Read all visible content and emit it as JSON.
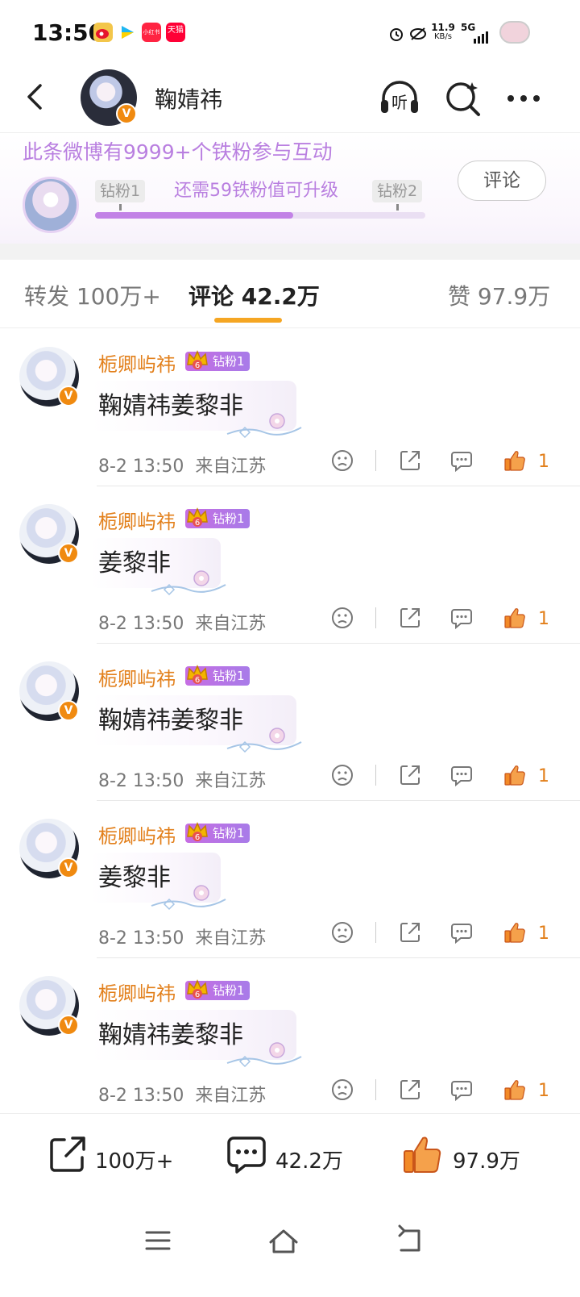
{
  "status_bar": {
    "time": "13:50",
    "app_icons": [
      {
        "name": "weibo-app-icon",
        "color": "#e6162d"
      },
      {
        "name": "video-app-icon",
        "color": "#1fb7f2"
      },
      {
        "name": "xiaohongshu-app-icon",
        "color": "#ff2442",
        "label": "小红书"
      },
      {
        "name": "tmall-app-icon",
        "color": "#ff0036",
        "label": "天猫"
      }
    ],
    "speed": "11.9",
    "speed_unit": "KB/s",
    "network": "5G"
  },
  "header": {
    "title": "鞠婧祎",
    "verified_mark": "V"
  },
  "fan_banner": {
    "title": "此条微博有9999+个铁粉参与互动",
    "level_current": "钻粉1",
    "level_message": "还需59铁粉值可升级",
    "level_next": "钻粉2",
    "progress": 0.6,
    "comment_button": "评论"
  },
  "tabs": [
    {
      "label": "转发 100万+",
      "active": false
    },
    {
      "label": "评论 42.2万",
      "active": true
    },
    {
      "label": "赞 97.9万",
      "active": false
    }
  ],
  "comments": [
    {
      "user": "栀卿屿祎",
      "badge": "钻粉1",
      "crown_level": "6",
      "verified": "V",
      "text": "鞠婧祎姜黎非",
      "time": "8-2 13:50",
      "location": "来自江苏",
      "likes": "1"
    },
    {
      "user": "栀卿屿祎",
      "badge": "钻粉1",
      "crown_level": "6",
      "verified": "V",
      "text": "姜黎非",
      "time": "8-2 13:50",
      "location": "来自江苏",
      "likes": "1"
    },
    {
      "user": "栀卿屿祎",
      "badge": "钻粉1",
      "crown_level": "6",
      "verified": "V",
      "text": "鞠婧祎姜黎非",
      "time": "8-2 13:50",
      "location": "来自江苏",
      "likes": "1"
    },
    {
      "user": "栀卿屿祎",
      "badge": "钻粉1",
      "crown_level": "6",
      "verified": "V",
      "text": "姜黎非",
      "time": "8-2 13:50",
      "location": "来自江苏",
      "likes": "1"
    },
    {
      "user": "栀卿屿祎",
      "badge": "钻粉1",
      "crown_level": "6",
      "verified": "V",
      "text": "鞠婧祎姜黎非",
      "time": "8-2 13:50",
      "location": "来自江苏",
      "likes": "1"
    }
  ],
  "bottom_bar": {
    "repost": "100万+",
    "comments": "42.2万",
    "likes": "97.9万"
  },
  "colors": {
    "accent_orange": "#e27f1a",
    "fan_purple": "#b97fe0",
    "tab_indicator": "#f5a623"
  }
}
